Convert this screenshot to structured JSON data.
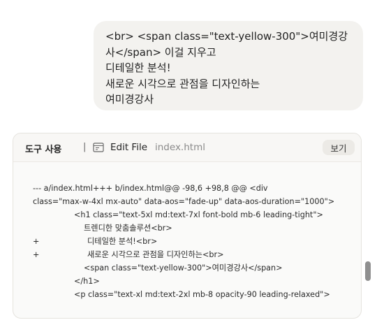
{
  "user_message": {
    "lines": [
      "<br> <span class=\"text-yellow-300\">여미경강",
      "사</span> 이걸 지우고",
      "디테일한 분석!",
      "새로운 시각으로 관점을 디자인하는",
      "여미경강사"
    ]
  },
  "tool": {
    "title": "도구 사용",
    "separator": "|",
    "icon": "edit-file-icon",
    "action_label": "Edit File",
    "file_name": "index.html",
    "view_label": "보기"
  },
  "diff": {
    "lines": [
      {
        "marker": "",
        "text": "--- a/index.html+++ b/index.html@@ -98,6 +98,8 @@            <div"
      },
      {
        "marker": "",
        "text": "class=\"max-w-4xl mx-auto\" data-aos=\"fade-up\" data-aos-duration=\"1000\">"
      },
      {
        "marker": "",
        "text": "<h1 class=\"text-5xl md:text-7xl font-bold mb-6 leading-tight\">"
      },
      {
        "marker": "",
        "text": "트렌디한 맞춤솔루션<br>"
      },
      {
        "marker": "+",
        "text": "디테일한 분석!<br>"
      },
      {
        "marker": "+",
        "text": "새로운 시각으로 관점을 디자인하는<br>"
      },
      {
        "marker": "",
        "text": "<span class=\"text-yellow-300\">여미경강사</span>"
      },
      {
        "marker": "",
        "text": "</h1>"
      },
      {
        "marker": "",
        "text": "<p class=\"text-xl md:text-2xl mb-8 opacity-90 leading-relaxed\">"
      }
    ]
  },
  "colors": {
    "bubble_bg": "#f3f2ef",
    "card_bg": "#fafaf9",
    "scrollbar": "#8f8f8f"
  }
}
